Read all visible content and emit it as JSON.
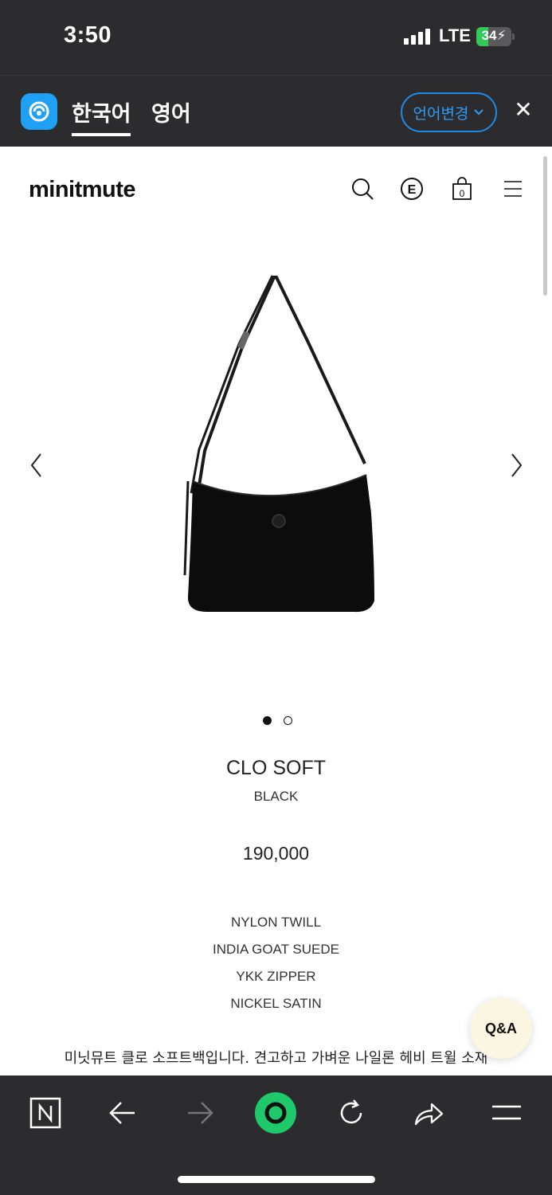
{
  "status_bar": {
    "time": "3:50",
    "network": "LTE",
    "battery": "34",
    "battery_level_percent": 34,
    "battery_color": "#34c759"
  },
  "translate_bar": {
    "icon": "papago-icon",
    "tabs": [
      {
        "label": "한국어",
        "active": true
      },
      {
        "label": "영어",
        "active": false
      }
    ],
    "change_language_label": "언어변경",
    "accent_color": "#1f8ae8"
  },
  "site_header": {
    "logo": "minitmute",
    "icons": [
      "search-icon",
      "currency-e-icon",
      "shopping-bag-icon",
      "menu-icon"
    ],
    "cart_count": "0"
  },
  "product": {
    "image": "black-shoulder-bag",
    "carousel": {
      "total": 2,
      "active_index": 0
    },
    "name": "CLO SOFT",
    "color": "BLACK",
    "price": "190,000",
    "specs": [
      "NYLON TWILL",
      "INDIA GOAT SUEDE",
      "YKK ZIPPER",
      "NICKEL SATIN"
    ],
    "description": "미닛뮤트 클로 소프트백입니다. 견고하고 가벼운 나일론 헤비 트윌 소재"
  },
  "qa_button": {
    "label": "Q&A",
    "color": "#fbf6e1"
  },
  "browser_toolbar": {
    "buttons": [
      "naver-icon",
      "back-arrow-icon",
      "forward-arrow-icon",
      "green-dot-icon",
      "reload-icon",
      "share-icon",
      "menu-icon"
    ],
    "accent_color": "#1ec86b"
  }
}
